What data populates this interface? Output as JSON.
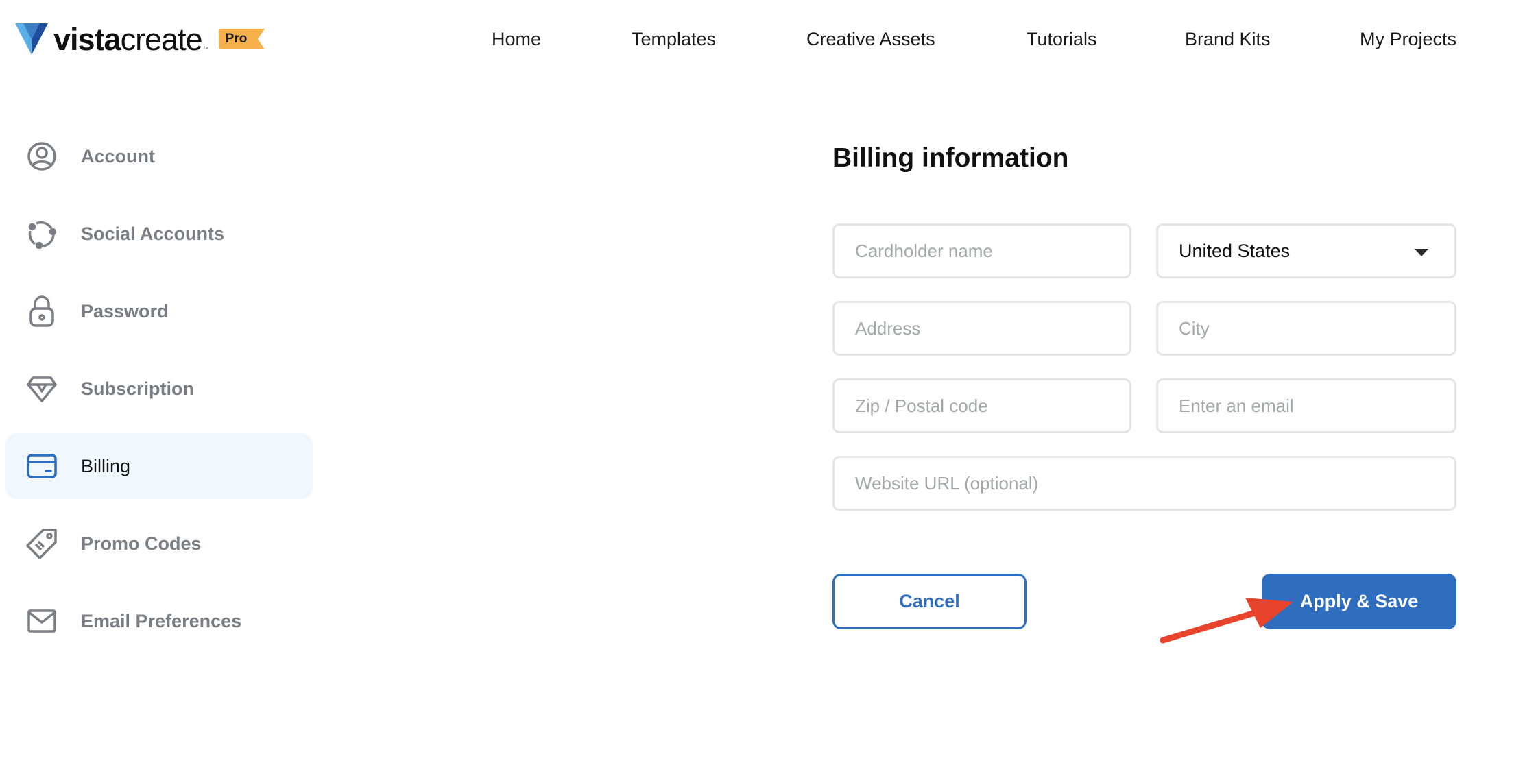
{
  "brand": {
    "logo_part1": "vista",
    "logo_part2": "create",
    "trademark": "™",
    "badge": "Pro",
    "colors": {
      "logo_light": "#5ab0e6",
      "logo_dark": "#1f4f9c",
      "badge": "#f6b14c"
    }
  },
  "nav": {
    "items": [
      {
        "label": "Home"
      },
      {
        "label": "Templates"
      },
      {
        "label": "Creative Assets"
      },
      {
        "label": "Tutorials"
      },
      {
        "label": "Brand Kits"
      },
      {
        "label": "My Projects"
      }
    ]
  },
  "sidebar": {
    "items": [
      {
        "label": "Account",
        "icon": "user-circle-icon",
        "active": false
      },
      {
        "label": "Social Accounts",
        "icon": "social-share-icon",
        "active": false
      },
      {
        "label": "Password",
        "icon": "lock-icon",
        "active": false
      },
      {
        "label": "Subscription",
        "icon": "diamond-icon",
        "active": false
      },
      {
        "label": "Billing",
        "icon": "credit-card-icon",
        "active": true
      },
      {
        "label": "Promo Codes",
        "icon": "tag-icon",
        "active": false
      },
      {
        "label": "Email Preferences",
        "icon": "envelope-icon",
        "active": false
      }
    ],
    "colors": {
      "inactive_text": "#7a7d84",
      "active_bg": "#f1f8fd",
      "active_icon": "#2f6ebf"
    }
  },
  "billing": {
    "title": "Billing information",
    "cardholder": {
      "placeholder": "Cardholder name",
      "value": ""
    },
    "country": {
      "value": "United States"
    },
    "address": {
      "placeholder": "Address",
      "value": ""
    },
    "city": {
      "placeholder": "City",
      "value": ""
    },
    "zip": {
      "placeholder": "Zip / Postal code",
      "value": ""
    },
    "email": {
      "placeholder": "Enter an email",
      "value": ""
    },
    "website": {
      "placeholder": "Website URL (optional)",
      "value": ""
    },
    "cancel_label": "Cancel",
    "apply_label": "Apply & Save",
    "colors": {
      "primary": "#2f6ebf",
      "annotation_arrow": "#e8442c"
    }
  }
}
